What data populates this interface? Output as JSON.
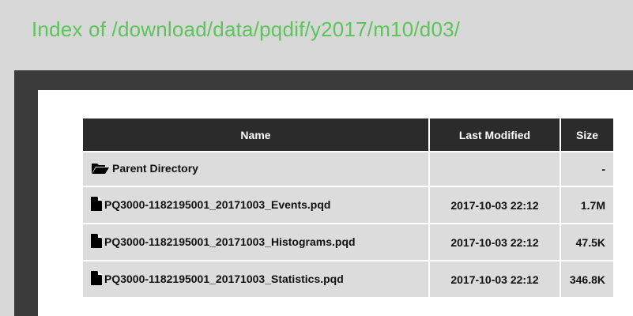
{
  "page": {
    "title": "Index of /download/data/pqdif/y2017/m10/d03/"
  },
  "table": {
    "headers": {
      "name": "Name",
      "modified": "Last Modified",
      "size": "Size"
    },
    "parent": {
      "label": "Parent Directory",
      "modified": "",
      "size": "-",
      "icon": "folder-open-icon"
    },
    "rows": [
      {
        "name": "PQ3000-1182195001_20171003_Events.pqd",
        "modified": "2017-10-03 22:12",
        "size": "1.7M",
        "icon": "file-icon"
      },
      {
        "name": "PQ3000-1182195001_20171003_Histograms.pqd",
        "modified": "2017-10-03 22:12",
        "size": "47.5K",
        "icon": "file-icon"
      },
      {
        "name": "PQ3000-1182195001_20171003_Statistics.pqd",
        "modified": "2017-10-03 22:12",
        "size": "346.8K",
        "icon": "file-icon"
      }
    ]
  },
  "colors": {
    "title": "#5cc45a",
    "header_bg": "#2b2b2b",
    "cell_bg": "#dcdcdc",
    "frame": "#3b3b3b",
    "page_bg": "#d8d8d8"
  }
}
